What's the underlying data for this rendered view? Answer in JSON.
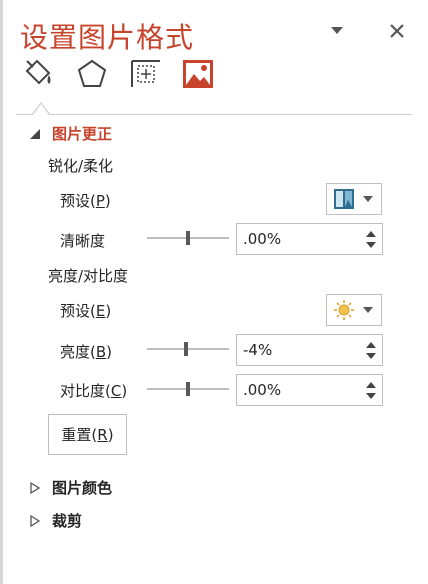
{
  "pane": {
    "title": "设置图片格式",
    "menu_icon": "dropdown-triangle-icon",
    "close_icon": "close-icon"
  },
  "tabs": [
    {
      "name": "fill-line",
      "icon": "paint-bucket-icon"
    },
    {
      "name": "effects",
      "icon": "pentagon-icon"
    },
    {
      "name": "size-properties",
      "icon": "size-layout-icon"
    },
    {
      "name": "picture",
      "icon": "picture-icon",
      "active": true
    }
  ],
  "correction": {
    "header": "图片更正",
    "sharpen_group": "锐化/柔化",
    "sharpen_preset_label": "预设(",
    "sharpen_preset_key": "P",
    "sharpen_preset_tail": ")",
    "sharpness_label": "清晰度",
    "sharpness_value": ".00%",
    "sharpness_level": 0.5,
    "bright_group": "亮度/对比度",
    "bright_preset_label": "预设(",
    "bright_preset_key": "E",
    "bright_preset_tail": ")",
    "brightness_label": "亮度(",
    "brightness_key": "B",
    "brightness_tail": ")",
    "brightness_value": "-4%",
    "brightness_level": 0.48,
    "contrast_label": "对比度(",
    "contrast_key": "C",
    "contrast_tail": ")",
    "contrast_value": ".00%",
    "contrast_level": 0.5,
    "reset_label": "重置(",
    "reset_key": "R",
    "reset_tail": ")"
  },
  "sections": {
    "color": "图片颜色",
    "crop": "裁剪"
  },
  "colors": {
    "accent": "#c8432b",
    "text": "#262626",
    "border": "#bfbfbf"
  }
}
